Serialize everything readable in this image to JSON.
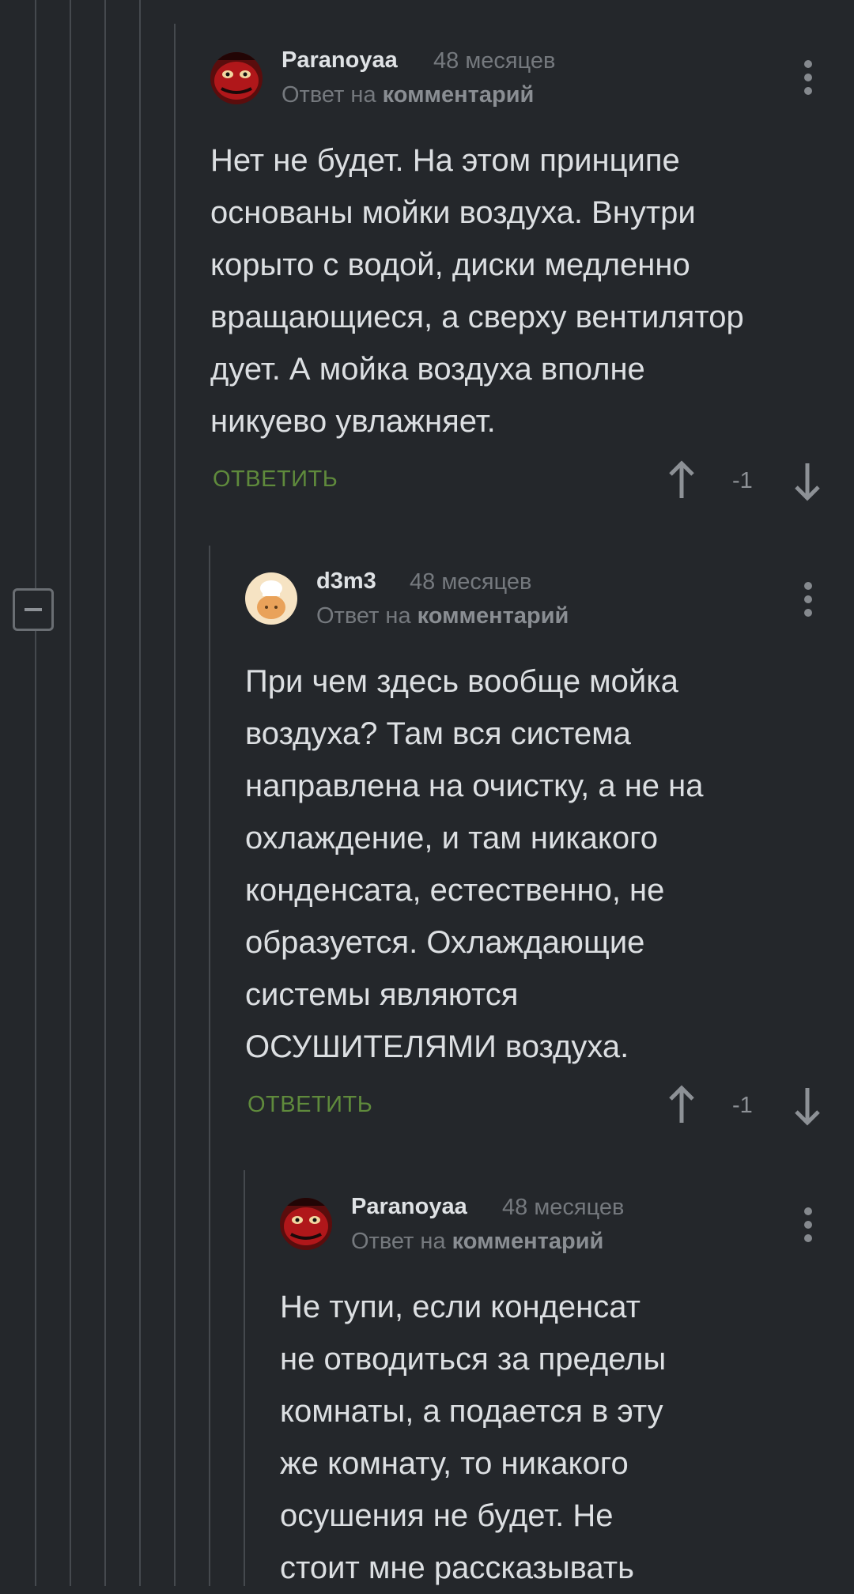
{
  "comments": [
    {
      "author": "Paranoyaa",
      "time": "48 месяцев",
      "reply_prefix": "Ответ на",
      "reply_link": "комментарий",
      "lines": [
        "Нет не будет. На этом принципе",
        "основаны мойки воздуха. Внутри",
        "корыто с водой, диски медленно",
        "вращающиеся, а сверху вентилятор",
        "дует. А мойка воздуха вполне",
        "никуево увлажняет."
      ],
      "reply_label": "ОТВЕТИТЬ",
      "score": "-1",
      "avatar": "red-mask-avatar"
    },
    {
      "author": "d3m3",
      "time": "48 месяцев",
      "reply_prefix": "Ответ на",
      "reply_link": "комментарий",
      "lines": [
        "При чем здесь вообще мойка",
        "воздуха? Там вся система",
        "направлена на очистку, а не на",
        "охлаждение, и там никакого",
        "конденсата, естественно, не",
        "образуется. Охлаждающие",
        "системы являются",
        "ОСУШИТЕЛЯМИ воздуха."
      ],
      "reply_label": "ОТВЕТИТЬ",
      "score": "-1",
      "avatar": "chef-avatar"
    },
    {
      "author": "Paranoyaa",
      "time": "48 месяцев",
      "reply_prefix": "Ответ на",
      "reply_link": "комментарий",
      "lines": [
        "Не тупи, если конденсат",
        "не отводиться за пределы",
        "комнаты, а подается в эту",
        "же комнату, то никакого",
        "осушения не будет. Не",
        "стоит мне рассказывать"
      ],
      "avatar": "red-mask-avatar"
    }
  ],
  "colors": {
    "background": "#24272b",
    "thread_line": "#45494e",
    "reply_green": "#5f8a3c",
    "muted": "#75797e"
  },
  "icons": [
    "collapse-icon",
    "more-vert-icon",
    "arrow-up-icon",
    "arrow-down-icon"
  ]
}
